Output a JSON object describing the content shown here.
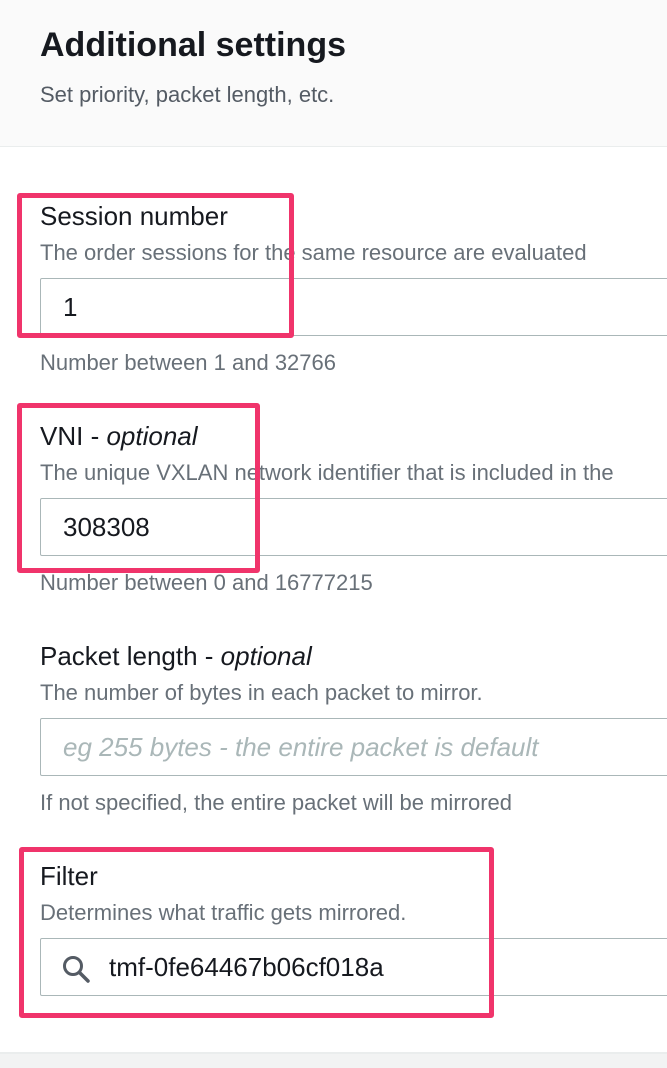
{
  "section": {
    "title": "Additional settings",
    "description": "Set priority, packet length, etc."
  },
  "session_number": {
    "label": "Session number",
    "description": "The order sessions for the same resource are evaluated",
    "value": "1",
    "hint": "Number between 1 and 32766"
  },
  "vni": {
    "label": "VNI - ",
    "optional": "optional",
    "description": "The unique VXLAN network identifier that is included in the",
    "value": "308308",
    "hint": "Number between 0 and 16777215"
  },
  "packet_length": {
    "label": "Packet length - ",
    "optional": "optional",
    "description": "The number of bytes in each packet to mirror.",
    "value": "",
    "placeholder": "eg 255 bytes - the entire packet is default",
    "hint": "If not specified, the entire packet will be mirrored"
  },
  "filter": {
    "label": "Filter",
    "description": "Determines what traffic gets mirrored.",
    "icon": "search-icon",
    "value": "tmf-0fe64467b06cf018a"
  },
  "colors": {
    "highlight": "#f0346b",
    "text_primary": "#16191f",
    "text_secondary": "#687078",
    "input_border": "#aab7b8",
    "header_bg": "#fafafa"
  }
}
